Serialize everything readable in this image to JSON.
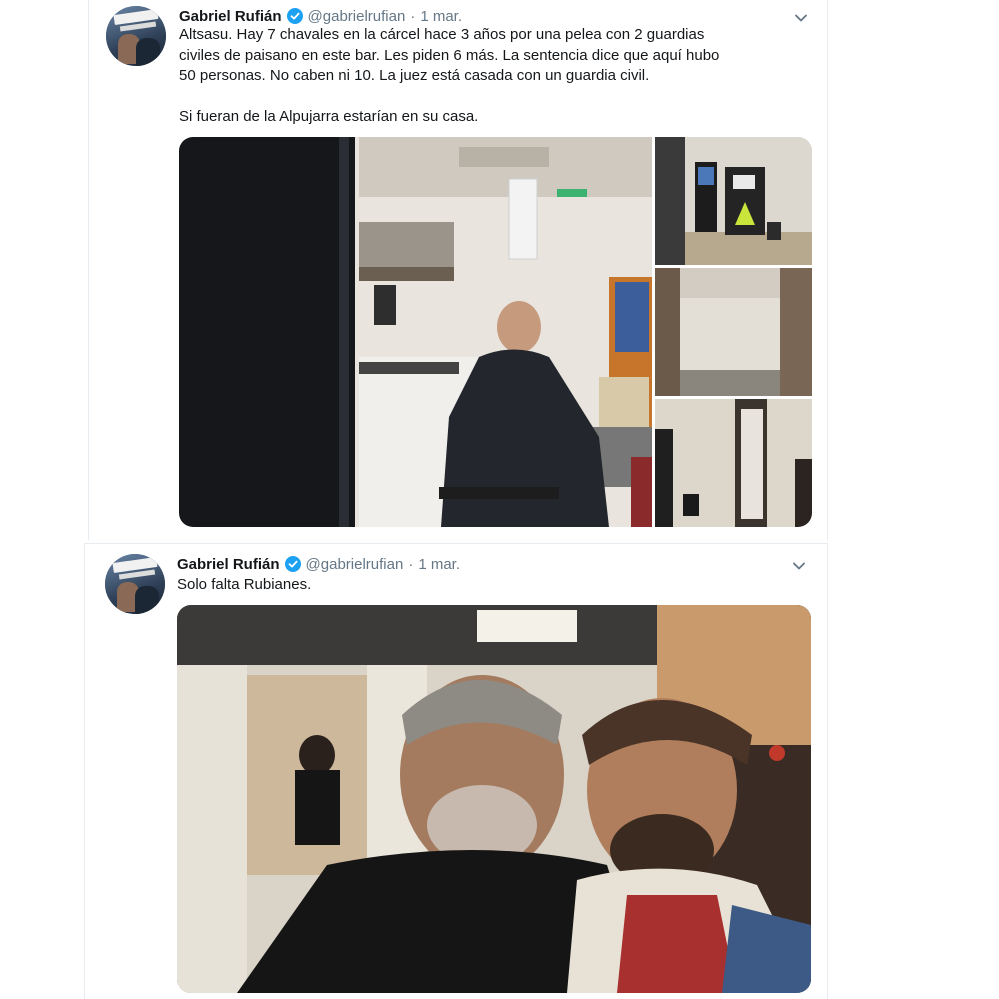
{
  "tweets": [
    {
      "author_name": "Gabriel Rufián",
      "handle": "@gabrielrufian",
      "separator": "·",
      "date": "1 mar.",
      "text_lines": [
        "Altsasu. Hay 7 chavales en la cárcel hace 3 años por una pelea con 2 guardias",
        "civiles de paisano en este bar. Les piden 6 más. La sentencia dice que aquí hubo",
        "50 personas. No caben ni 10. La juez está casada con un guardia civil."
      ],
      "text_second_paragraph": "Si fueran de la Alpujarra estarían en su casa.",
      "avatar_text": "LA LIBERTAD",
      "photos": [
        "bar-interior-slot-machine",
        "bar-machines-corner",
        "bar-wall-panel",
        "bar-doorway"
      ]
    },
    {
      "author_name": "Gabriel Rufián",
      "handle": "@gabrielrufian",
      "separator": "·",
      "date": "1 mar.",
      "text": "Solo falta Rubianes.",
      "avatar_text": "LA LIBERTAD",
      "photos": [
        "selfie-two-men-in-bar"
      ]
    }
  ],
  "colors": {
    "verified": "#1da1f2",
    "secondary_text": "#657786",
    "primary_text": "#14171a",
    "border": "#e6ecf0"
  },
  "icons": [
    "verified-badge-icon",
    "chevron-down-icon"
  ]
}
